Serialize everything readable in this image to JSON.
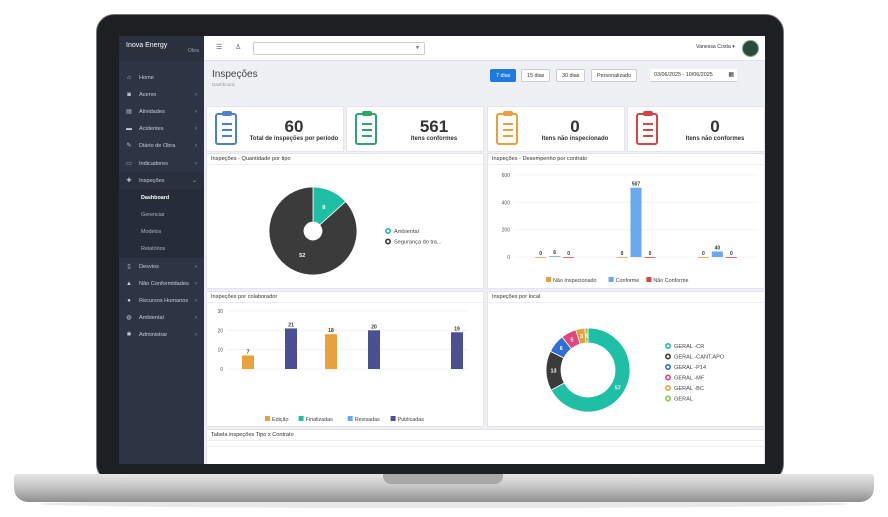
{
  "brand": {
    "name": "Inova Energy",
    "sub": "Obra"
  },
  "sidebar": {
    "items": [
      {
        "label": "Home",
        "icon": "home-icon"
      },
      {
        "label": "Acervo",
        "icon": "camera-icon"
      },
      {
        "label": "Atividades",
        "icon": "briefcase-icon"
      },
      {
        "label": "Acidentes",
        "icon": "truck-icon"
      },
      {
        "label": "Diário de Obra",
        "icon": "pencil-icon"
      },
      {
        "label": "Indicadores",
        "icon": "folder-icon"
      },
      {
        "label": "Inspeções",
        "icon": "puzzle-icon"
      }
    ],
    "sub_items": [
      "Dashboard",
      "Gerenciar",
      "Modelos",
      "Relatórios"
    ],
    "items_after": [
      {
        "label": "Desvios",
        "icon": "file-icon"
      },
      {
        "label": "Não Conformidades",
        "icon": "warning-icon"
      },
      {
        "label": "Recursos Humanos",
        "icon": "user-icon"
      },
      {
        "label": "Ambiental",
        "icon": "globe-icon"
      },
      {
        "label": "Administrar",
        "icon": "gear-icon"
      }
    ]
  },
  "topbar": {
    "user": "Vanessa Costa"
  },
  "header": {
    "title": "Inspeções",
    "breadcrumb": "Dashboard"
  },
  "periods": [
    "7 dias",
    "15 dias",
    "30 dias",
    "Personalizado"
  ],
  "date_range": "03/06/2025 - 10/06/2025",
  "kpis": [
    {
      "value": "60",
      "label": "Total de inspeções por período",
      "color": "#4a7fd4"
    },
    {
      "value": "561",
      "label": "Itens conformes",
      "color": "#2ea56b"
    },
    {
      "value": "0",
      "label": "Itens não inspecionado",
      "color": "#e9a23b"
    },
    {
      "value": "0",
      "label": "Itens não conformes",
      "color": "#d64545"
    }
  ],
  "panels": {
    "p1": "Inspeções - Quantidade por tipo",
    "p2": "Inspeções - Desempenho por contrato",
    "p3": "Inspeções por colaborador",
    "p4": "Inspeções por local",
    "p5": "Tabela inspeções Tipo x Contrato"
  },
  "chart_data": [
    {
      "type": "pie",
      "title": "Inspeções - Quantidade por tipo",
      "slices": [
        {
          "name": "Ambiental",
          "value": 8,
          "color": "#1fbfa6"
        },
        {
          "name": "Segurança do tra...",
          "value": 52,
          "color": "#3b3b3b"
        }
      ]
    },
    {
      "type": "bar",
      "title": "Inspeções - Desempenho por contrato",
      "ylim": [
        0,
        600
      ],
      "yticks": [
        0,
        200,
        400,
        600
      ],
      "groups": 3,
      "series": [
        {
          "name": "Não Inspecionado",
          "color": "#e9a23b",
          "values": [
            0,
            0,
            0
          ]
        },
        {
          "name": "Conforme",
          "color": "#6aa8f0",
          "values": [
            6,
            507,
            40
          ]
        },
        {
          "name": "Não Conforme",
          "color": "#d64545",
          "values": [
            0,
            0,
            0
          ]
        }
      ]
    },
    {
      "type": "bar",
      "title": "Inspeções por colaborador",
      "ylim": [
        0,
        30
      ],
      "yticks": [
        0,
        10,
        20,
        30
      ],
      "bars": [
        {
          "value": 7,
          "series": "Edição"
        },
        {
          "value": 21,
          "series": "Publicadas"
        },
        {
          "value": 18,
          "series": "Edição"
        },
        {
          "value": 20,
          "series": "Publicadas"
        },
        {
          "value": 19,
          "series": "Publicadas"
        }
      ],
      "series": [
        {
          "name": "Edição",
          "color": "#e9a23b"
        },
        {
          "name": "Finalizadas",
          "color": "#1fbfa6"
        },
        {
          "name": "Revisadas",
          "color": "#6aa8f0"
        },
        {
          "name": "Publicadas",
          "color": "#4b4f93"
        }
      ]
    },
    {
      "type": "pie",
      "title": "Inspeções por local",
      "slices": [
        {
          "name": "GERAL -CR",
          "value": 57,
          "color": "#1fbfa6"
        },
        {
          "name": "GERAL -CANT.APO",
          "value": 13,
          "color": "#3b3b3b"
        },
        {
          "name": "GERAL -P14",
          "value": 6,
          "color": "#2e6fd6"
        },
        {
          "name": "GERAL -MF",
          "value": 5,
          "color": "#e0457b"
        },
        {
          "name": "GERAL -BC",
          "value": 3,
          "color": "#e9a23b"
        },
        {
          "name": "GERAL",
          "value": 1,
          "color": "#8cc63f"
        }
      ]
    }
  ]
}
